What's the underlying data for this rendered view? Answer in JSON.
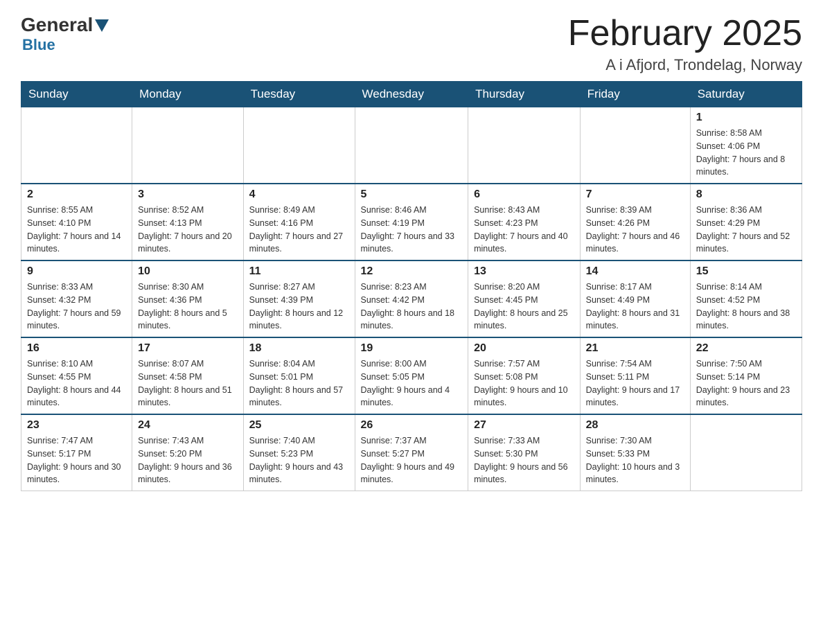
{
  "header": {
    "logo": {
      "line1": "General",
      "line2": "Blue"
    },
    "title": "February 2025",
    "location": "A i Afjord, Trondelag, Norway"
  },
  "days_of_week": [
    "Sunday",
    "Monday",
    "Tuesday",
    "Wednesday",
    "Thursday",
    "Friday",
    "Saturday"
  ],
  "weeks": [
    [
      {
        "day": "",
        "info": ""
      },
      {
        "day": "",
        "info": ""
      },
      {
        "day": "",
        "info": ""
      },
      {
        "day": "",
        "info": ""
      },
      {
        "day": "",
        "info": ""
      },
      {
        "day": "",
        "info": ""
      },
      {
        "day": "1",
        "info": "Sunrise: 8:58 AM\nSunset: 4:06 PM\nDaylight: 7 hours and 8 minutes."
      }
    ],
    [
      {
        "day": "2",
        "info": "Sunrise: 8:55 AM\nSunset: 4:10 PM\nDaylight: 7 hours and 14 minutes."
      },
      {
        "day": "3",
        "info": "Sunrise: 8:52 AM\nSunset: 4:13 PM\nDaylight: 7 hours and 20 minutes."
      },
      {
        "day": "4",
        "info": "Sunrise: 8:49 AM\nSunset: 4:16 PM\nDaylight: 7 hours and 27 minutes."
      },
      {
        "day": "5",
        "info": "Sunrise: 8:46 AM\nSunset: 4:19 PM\nDaylight: 7 hours and 33 minutes."
      },
      {
        "day": "6",
        "info": "Sunrise: 8:43 AM\nSunset: 4:23 PM\nDaylight: 7 hours and 40 minutes."
      },
      {
        "day": "7",
        "info": "Sunrise: 8:39 AM\nSunset: 4:26 PM\nDaylight: 7 hours and 46 minutes."
      },
      {
        "day": "8",
        "info": "Sunrise: 8:36 AM\nSunset: 4:29 PM\nDaylight: 7 hours and 52 minutes."
      }
    ],
    [
      {
        "day": "9",
        "info": "Sunrise: 8:33 AM\nSunset: 4:32 PM\nDaylight: 7 hours and 59 minutes."
      },
      {
        "day": "10",
        "info": "Sunrise: 8:30 AM\nSunset: 4:36 PM\nDaylight: 8 hours and 5 minutes."
      },
      {
        "day": "11",
        "info": "Sunrise: 8:27 AM\nSunset: 4:39 PM\nDaylight: 8 hours and 12 minutes."
      },
      {
        "day": "12",
        "info": "Sunrise: 8:23 AM\nSunset: 4:42 PM\nDaylight: 8 hours and 18 minutes."
      },
      {
        "day": "13",
        "info": "Sunrise: 8:20 AM\nSunset: 4:45 PM\nDaylight: 8 hours and 25 minutes."
      },
      {
        "day": "14",
        "info": "Sunrise: 8:17 AM\nSunset: 4:49 PM\nDaylight: 8 hours and 31 minutes."
      },
      {
        "day": "15",
        "info": "Sunrise: 8:14 AM\nSunset: 4:52 PM\nDaylight: 8 hours and 38 minutes."
      }
    ],
    [
      {
        "day": "16",
        "info": "Sunrise: 8:10 AM\nSunset: 4:55 PM\nDaylight: 8 hours and 44 minutes."
      },
      {
        "day": "17",
        "info": "Sunrise: 8:07 AM\nSunset: 4:58 PM\nDaylight: 8 hours and 51 minutes."
      },
      {
        "day": "18",
        "info": "Sunrise: 8:04 AM\nSunset: 5:01 PM\nDaylight: 8 hours and 57 minutes."
      },
      {
        "day": "19",
        "info": "Sunrise: 8:00 AM\nSunset: 5:05 PM\nDaylight: 9 hours and 4 minutes."
      },
      {
        "day": "20",
        "info": "Sunrise: 7:57 AM\nSunset: 5:08 PM\nDaylight: 9 hours and 10 minutes."
      },
      {
        "day": "21",
        "info": "Sunrise: 7:54 AM\nSunset: 5:11 PM\nDaylight: 9 hours and 17 minutes."
      },
      {
        "day": "22",
        "info": "Sunrise: 7:50 AM\nSunset: 5:14 PM\nDaylight: 9 hours and 23 minutes."
      }
    ],
    [
      {
        "day": "23",
        "info": "Sunrise: 7:47 AM\nSunset: 5:17 PM\nDaylight: 9 hours and 30 minutes."
      },
      {
        "day": "24",
        "info": "Sunrise: 7:43 AM\nSunset: 5:20 PM\nDaylight: 9 hours and 36 minutes."
      },
      {
        "day": "25",
        "info": "Sunrise: 7:40 AM\nSunset: 5:23 PM\nDaylight: 9 hours and 43 minutes."
      },
      {
        "day": "26",
        "info": "Sunrise: 7:37 AM\nSunset: 5:27 PM\nDaylight: 9 hours and 49 minutes."
      },
      {
        "day": "27",
        "info": "Sunrise: 7:33 AM\nSunset: 5:30 PM\nDaylight: 9 hours and 56 minutes."
      },
      {
        "day": "28",
        "info": "Sunrise: 7:30 AM\nSunset: 5:33 PM\nDaylight: 10 hours and 3 minutes."
      },
      {
        "day": "",
        "info": ""
      }
    ]
  ]
}
